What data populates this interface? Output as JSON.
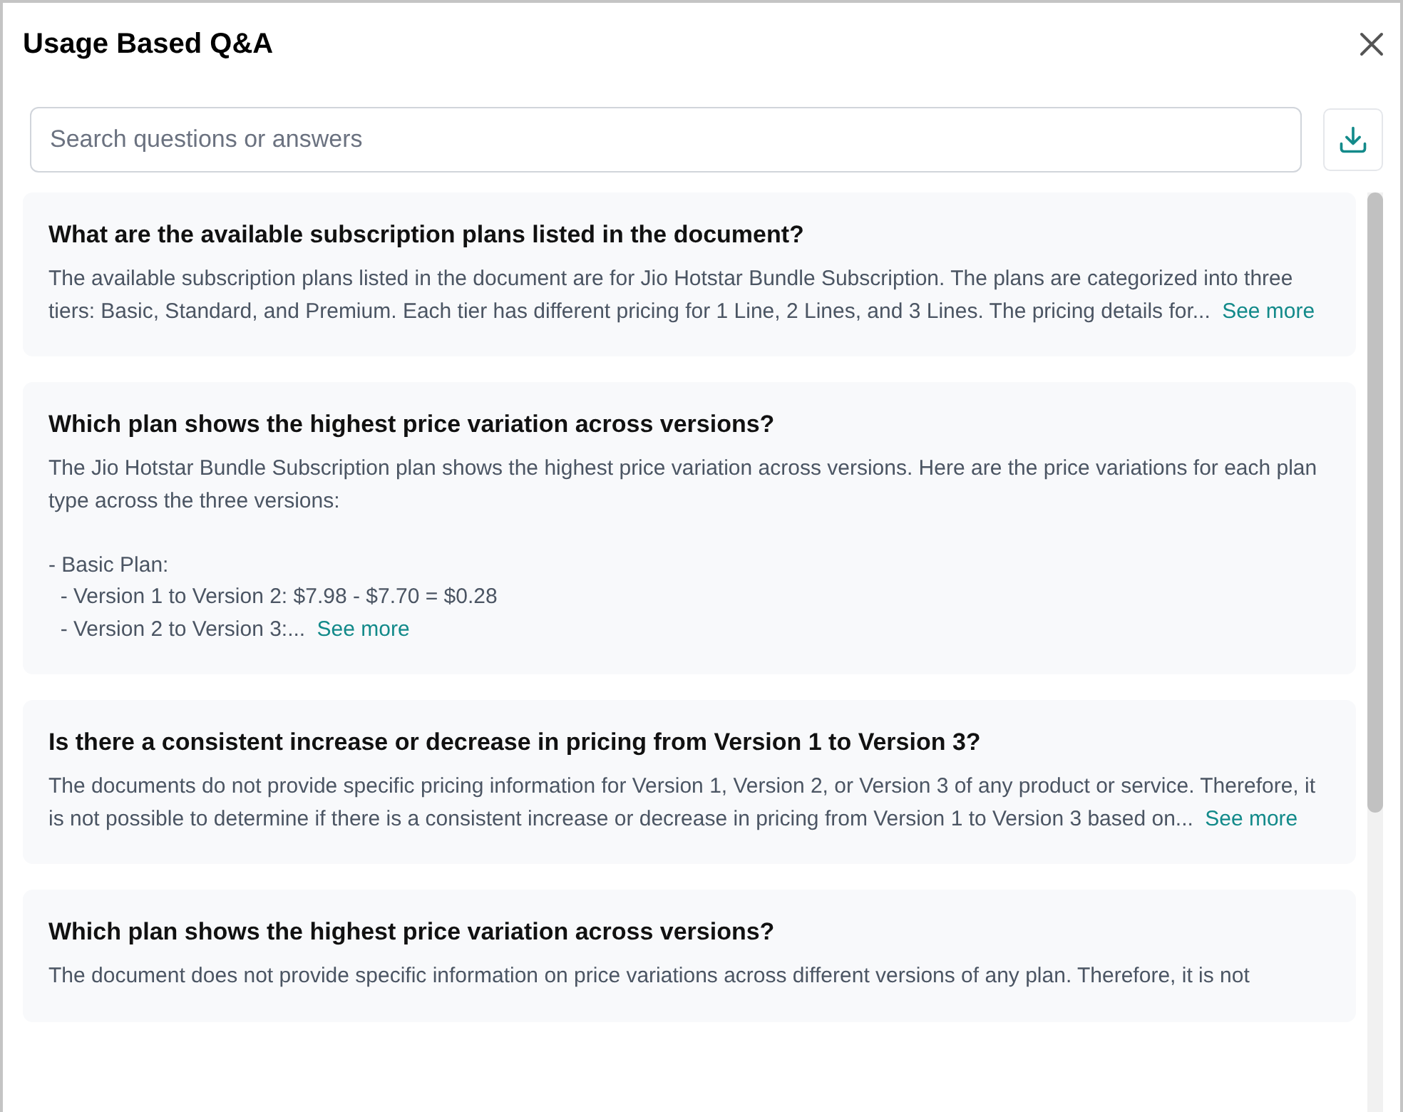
{
  "window": {
    "title": "Usage Based Q&A"
  },
  "search": {
    "placeholder": "Search questions or answers"
  },
  "items": [
    {
      "question": "What are the available subscription plans listed in the document?",
      "answer": "The available subscription plans listed in the document are for Jio Hotstar Bundle Subscription. The plans are categorized into three tiers: Basic, Standard, and Premium. Each tier has different pricing for 1 Line, 2 Lines, and 3 Lines. The pricing details for...",
      "link": "See more"
    },
    {
      "question": "Which plan shows the highest price variation across versions?",
      "answer": "The Jio Hotstar Bundle Subscription plan shows the highest price variation across versions. Here are the price variations for each plan type across the three versions:\n\n- Basic Plan:\n  - Version 1 to Version 2: $7.98 - $7.70 = $0.28\n  - Version 2 to Version 3:...",
      "link": "See more"
    },
    {
      "question": "Is there a consistent increase or decrease in pricing from Version 1 to Version 3?",
      "answer": "The documents do not provide specific pricing information for Version 1, Version 2, or Version 3 of any product or service. Therefore, it is not possible to determine if there is a consistent increase or decrease in pricing from Version 1 to Version 3 based on...",
      "link": "See more"
    },
    {
      "question": "Which plan shows the highest price variation across versions?",
      "answer": "The document does not provide specific information on price variations across different versions of any plan. Therefore, it is not"
    }
  ]
}
